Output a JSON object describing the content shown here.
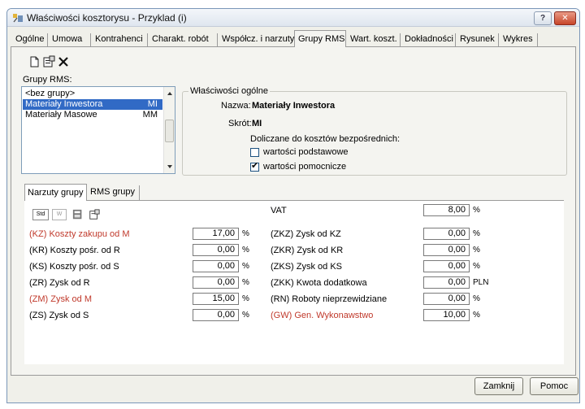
{
  "window": {
    "title": "Właściwości kosztorysu - Przyklad (i)",
    "help_button": "?",
    "close_button": "✕"
  },
  "tabs": [
    "Ogólne",
    "Umowa",
    "Kontrahenci",
    "Charakt. robót",
    "Współcz. i narzuty",
    "Grupy RMS",
    "Wart. koszt.",
    "Dokładności",
    "Rysunek",
    "Wykres"
  ],
  "active_tab": "Grupy RMS",
  "toolbar": {
    "icons": [
      "new-icon",
      "properties-icon",
      "delete-icon"
    ]
  },
  "groups": {
    "label": "Grupy RMS:",
    "items": [
      {
        "name": "<bez grupy>",
        "code": ""
      },
      {
        "name": "Materiały Inwestora",
        "code": "MI",
        "selected": true
      },
      {
        "name": "Materiały Masowe",
        "code": "MM"
      }
    ]
  },
  "properties": {
    "title": "Właściwości ogólne",
    "name_label": "Nazwa:",
    "name_value": "Materiały Inwestora",
    "short_label": "Skrót:",
    "short_value": "MI",
    "direct_costs_label": "Doliczane do kosztów bezpośrednich:",
    "checkbox_base": {
      "label": "wartości podstawowe",
      "checked": false
    },
    "checkbox_aux": {
      "label": "wartości pomocnicze",
      "checked": true
    }
  },
  "subtabs": [
    "Narzuty grupy",
    "RMS grupy"
  ],
  "rates": {
    "icons": [
      "std-icon",
      "w-icon",
      "copy-icon",
      "properties-icon"
    ],
    "std_text": "Std",
    "w_text": "W",
    "left": [
      {
        "label": "(KZ) Koszty zakupu od M",
        "value": "17,00",
        "unit": "%",
        "red": true
      },
      {
        "label": "(KR) Koszty pośr. od R",
        "value": "0,00",
        "unit": "%",
        "red": false
      },
      {
        "label": "(KS) Koszty pośr. od S",
        "value": "0,00",
        "unit": "%",
        "red": false
      },
      {
        "label": "(ZR) Zysk od R",
        "value": "0,00",
        "unit": "%",
        "red": false
      },
      {
        "label": "(ZM) Zysk od M",
        "value": "15,00",
        "unit": "%",
        "red": true
      },
      {
        "label": "(ZS) Zysk od S",
        "value": "0,00",
        "unit": "%",
        "red": false
      }
    ],
    "vat": {
      "label": "VAT",
      "value": "8,00",
      "unit": "%"
    },
    "right": [
      {
        "label": "(ZKZ) Zysk od KZ",
        "value": "0,00",
        "unit": "%",
        "red": false
      },
      {
        "label": "(ZKR) Zysk od KR",
        "value": "0,00",
        "unit": "%",
        "red": false
      },
      {
        "label": "(ZKS) Zysk od KS",
        "value": "0,00",
        "unit": "%",
        "red": false
      },
      {
        "label": "(ZKK) Kwota dodatkowa",
        "value": "0,00",
        "unit": "PLN",
        "red": false
      },
      {
        "label": "(RN) Roboty nieprzewidziane",
        "value": "0,00",
        "unit": "%",
        "red": false
      },
      {
        "label": "(GW) Gen. Wykonawstwo",
        "value": "10,00",
        "unit": "%",
        "red": true
      }
    ]
  },
  "footer": {
    "close_label": "Zamknij",
    "help_label": "Pomoc"
  },
  "colors": {
    "accent": "#316ac5",
    "red_label": "#c0392b",
    "title_close": "#c74528"
  }
}
